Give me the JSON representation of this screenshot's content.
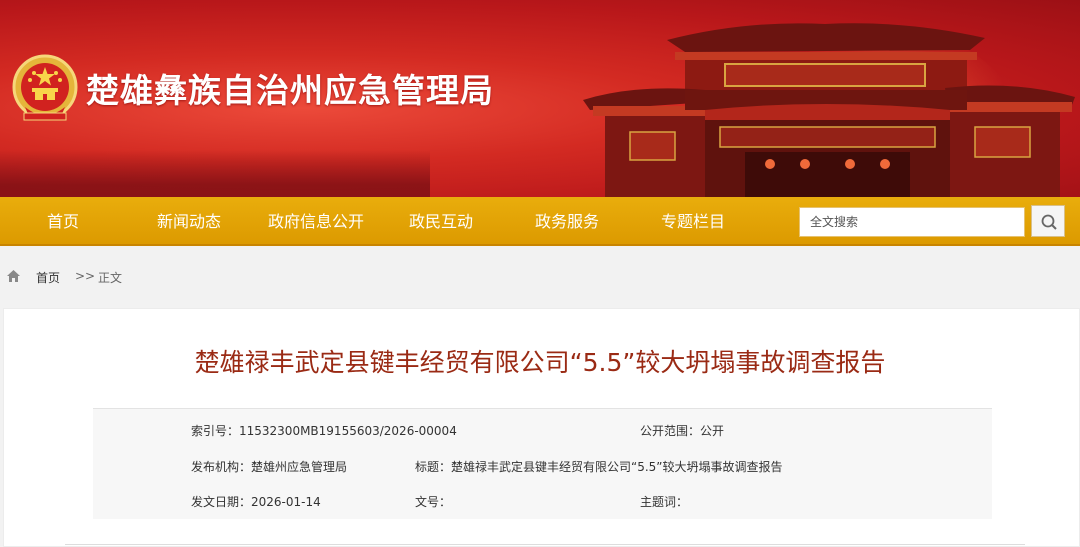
{
  "site": {
    "title": "楚雄彝族自治州应急管理局"
  },
  "nav": {
    "items": [
      "首页",
      "新闻动态",
      "政府信息公开",
      "政民互动",
      "政务服务",
      "专题栏目"
    ],
    "search_placeholder": "全文搜索"
  },
  "breadcrumb": {
    "home": "首页",
    "separator": ">>",
    "current": "正文"
  },
  "article": {
    "title": "楚雄禄丰武定县键丰经贸有限公司“5.5”较大坍塌事故调查报告"
  },
  "meta": {
    "index_no": "索引号：11532300MB19155603/2026-00004",
    "scope": "公开范围：公开",
    "publisher": "发布机构：楚雄州应急管理局",
    "subject": "标题：楚雄禄丰武定县键丰经贸有限公司“5.5”较大坍塌事故调查报告",
    "date": "发文日期：2026-01-14",
    "doc_no": "文号：",
    "keywords": "主题词："
  },
  "colors": {
    "banner_red": "#c81e1e",
    "nav_gold": "#e3a307",
    "title_red": "#9a2a14"
  },
  "icons": [
    "national-emblem-icon",
    "search-icon",
    "home-icon"
  ]
}
